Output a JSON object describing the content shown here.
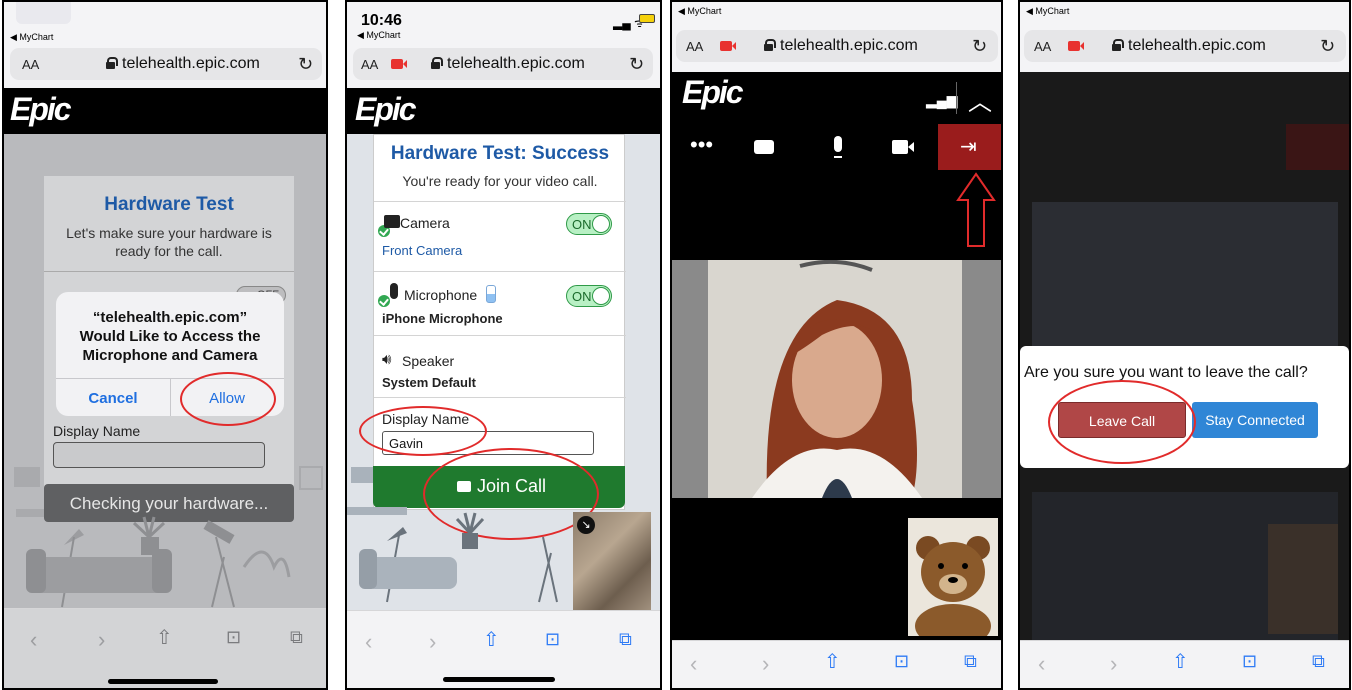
{
  "browser": {
    "back_label": "◀ MyChart",
    "text_size_label": "AA",
    "url": "telehealth.epic.com",
    "brand": "Epic",
    "accent_color": "#1e5aa6",
    "call_red": "#9a1c1c",
    "join_green": "#1f7a2e"
  },
  "screen1": {
    "card_title": "Hardware Test",
    "card_text": "Let's make sure your hardware is ready for the call.",
    "toggle_off": "OFF",
    "dialog_text": "“telehealth.epic.com” Would Like to Access the Microphone and Camera",
    "cancel_label": "Cancel",
    "allow_label": "Allow",
    "display_name_label": "Display Name",
    "toast_text": "Checking your hardware..."
  },
  "screen2": {
    "time": "10:46",
    "title": "Hardware Test: Success",
    "subtitle": "You're ready for your video call.",
    "camera_label": "Camera",
    "camera_device": "Front Camera",
    "toggle_on": "ON",
    "mic_label": "Microphone",
    "mic_device": "iPhone Microphone",
    "speaker_label": "Speaker",
    "speaker_device": "System Default",
    "display_name_label": "Display Name",
    "display_name_value": "Gavin",
    "join_label": "Join Call"
  },
  "screen4": {
    "confirm_text": "Are you sure you want to leave the call?",
    "leave_label": "Leave Call",
    "stay_label": "Stay Connected"
  }
}
